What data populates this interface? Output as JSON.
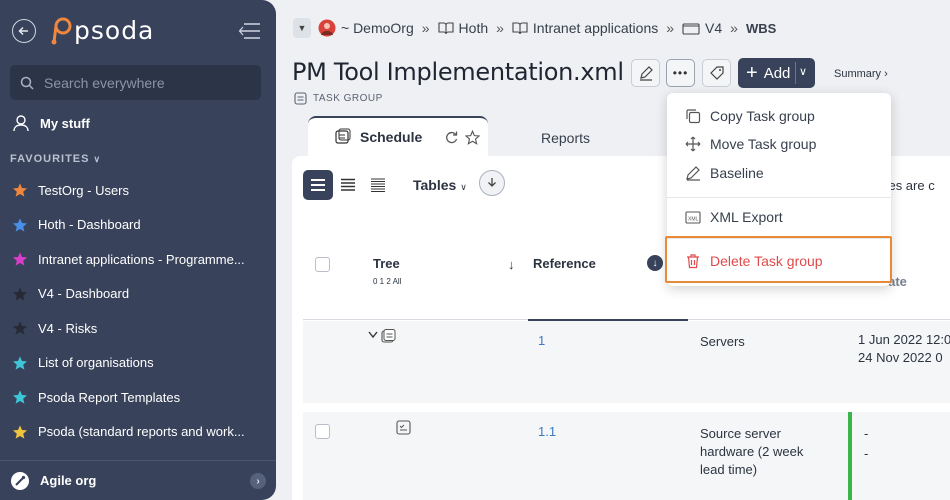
{
  "sidebar": {
    "logo_text": "psoda",
    "search_placeholder": "Search everywhere",
    "my_stuff": "My stuff",
    "favourites_header": "FAVOURITES",
    "favourites": [
      {
        "label": "TestOrg - Users",
        "star_color": "#f0873c"
      },
      {
        "label": "Hoth - Dashboard",
        "star_color": "#4a8fe8"
      },
      {
        "label": "Intranet applications - Programme...",
        "star_color": "#d83ec8"
      },
      {
        "label": "V4 - Dashboard",
        "star_color": "#2a2f3a"
      },
      {
        "label": "V4 - Risks",
        "star_color": "#2a2f3a"
      },
      {
        "label": "List of organisations",
        "star_color": "#3ec6d8"
      },
      {
        "label": "Psoda Report Templates",
        "star_color": "#3ec6d8"
      },
      {
        "label": "Psoda (standard reports and work...",
        "star_color": "#f0c43c"
      }
    ],
    "bottom_org": "Agile org"
  },
  "breadcrumb": [
    {
      "label": "~ DemoOrg",
      "icon": "org-avatar-icon"
    },
    {
      "label": "Hoth",
      "icon": "book-icon"
    },
    {
      "label": "Intranet applications",
      "icon": "book-icon"
    },
    {
      "label": "V4",
      "icon": "folder-icon"
    },
    {
      "label": "WBS",
      "icon": ""
    }
  ],
  "page": {
    "title": "PM Tool Implementation.xml",
    "subtitle": "TASK GROUP",
    "add_label": "Add",
    "summary_label": "Summary ›"
  },
  "tabs": {
    "schedule": "Schedule",
    "reports": "Reports"
  },
  "toolbar": {
    "tables_label": "Tables",
    "clipped_note": "ones are c"
  },
  "table": {
    "headers": {
      "tree": "Tree",
      "tree_levels": "0 1 2 All",
      "reference": "Reference",
      "date_top": "date",
      "date_bottom": "End date"
    },
    "rows": [
      {
        "reference": "1",
        "name": "Servers",
        "start": "1 Jun 2022 12:0",
        "end": "24 Nov 2022 0"
      },
      {
        "reference": "1.1",
        "name": "Source server hardware (2 week lead time)",
        "start": "-",
        "end": "-"
      }
    ]
  },
  "menu": {
    "items": [
      {
        "label": "Copy Task group",
        "icon": "copy-icon"
      },
      {
        "label": "Move Task group",
        "icon": "move-icon"
      },
      {
        "label": "Baseline",
        "icon": "pencil-icon"
      },
      {
        "label": "XML Export",
        "icon": "xml-icon"
      },
      {
        "label": "Delete Task group",
        "icon": "trash-icon"
      }
    ],
    "delete_color": "#e04a4a",
    "highlight_color": "#e98a3a"
  },
  "colors": {
    "sidebar_bg": "#38425a",
    "accent_dark": "#38425a",
    "link": "#3a7ac3",
    "status_green": "#3bb54a"
  }
}
